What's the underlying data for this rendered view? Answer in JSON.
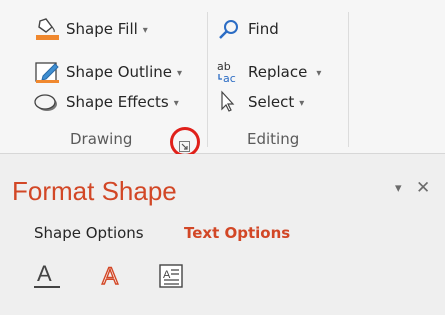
{
  "ribbon": {
    "drawing": {
      "items": [
        {
          "label": "Shape Fill",
          "icon": "paint-bucket-icon",
          "has_dropdown": true
        },
        {
          "label": "Shape Outline",
          "icon": "pencil-outline-icon",
          "has_dropdown": true
        },
        {
          "label": "Shape Effects",
          "icon": "shape-effects-icon",
          "has_dropdown": true
        }
      ],
      "group_label": "Drawing",
      "launcher_icon": "dialog-launcher-icon"
    },
    "editing": {
      "items": [
        {
          "label": "Find",
          "icon": "magnifier-icon",
          "has_dropdown": false
        },
        {
          "label": "Replace",
          "icon": "replace-icon",
          "has_dropdown": true
        },
        {
          "label": "Select",
          "icon": "cursor-arrow-icon",
          "has_dropdown": true
        }
      ],
      "group_label": "Editing"
    },
    "caret_glyph": "▾"
  },
  "pane": {
    "title": "Format Shape",
    "dropdown_glyph": "▾",
    "close_glyph": "✕",
    "tabs": [
      {
        "label": "Shape Options",
        "active": false
      },
      {
        "label": "Text Options",
        "active": true
      }
    ],
    "text_icons": [
      "text-fill-outline-icon",
      "text-effects-icon",
      "textbox-icon"
    ],
    "accent_color": "#d24726"
  },
  "annotation": {
    "highlight_color": "#e0201a"
  }
}
